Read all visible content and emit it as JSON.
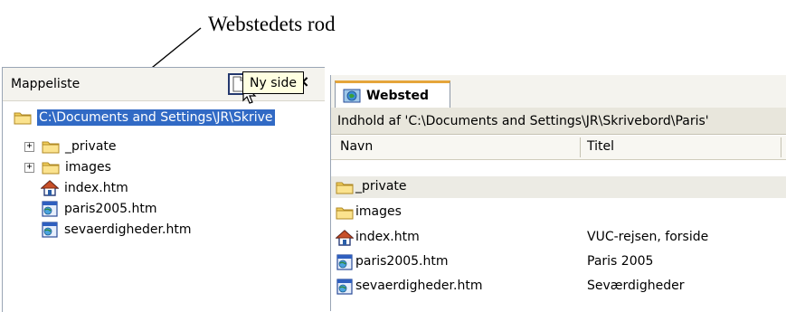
{
  "annotation": {
    "text": "Webstedets rod"
  },
  "folder_pane": {
    "title": "Mappeliste",
    "buttons": {
      "new_page": "new-page-icon",
      "new_folder": "folder-icon",
      "close": "×"
    },
    "tooltip": "Ny side",
    "root": {
      "label": "C:\\Documents and Settings\\JR\\Skrive",
      "icon": "folder-icon"
    },
    "items": [
      {
        "label": "_private",
        "icon": "folder-icon",
        "expandable": true
      },
      {
        "label": "images",
        "icon": "folder-icon",
        "expandable": true
      },
      {
        "label": "index.htm",
        "icon": "home-page-icon",
        "expandable": false
      },
      {
        "label": "paris2005.htm",
        "icon": "web-page-icon",
        "expandable": false
      },
      {
        "label": "sevaerdigheder.htm",
        "icon": "web-page-icon",
        "expandable": false
      }
    ]
  },
  "content_pane": {
    "tab_label": "Websted",
    "path_text": "Indhold af 'C:\\Documents and Settings\\JR\\Skrivebord\\Paris'",
    "columns": {
      "name": "Navn",
      "title": "Titel"
    },
    "rows": [
      {
        "name": "_private",
        "title": "",
        "icon": "folder-icon"
      },
      {
        "name": "images",
        "title": "",
        "icon": "folder-icon"
      },
      {
        "name": "index.htm",
        "title": "VUC-rejsen, forside",
        "icon": "home-page-icon"
      },
      {
        "name": "paris2005.htm",
        "title": "Paris 2005",
        "icon": "web-page-icon"
      },
      {
        "name": "sevaerdigheder.htm",
        "title": "Seværdigheder",
        "icon": "web-page-icon"
      }
    ]
  },
  "colors": {
    "selection": "#316ac5",
    "tooltip_bg": "#ffffe1",
    "tab_accent": "#e5a53b",
    "folder": "#f2cf5b"
  }
}
